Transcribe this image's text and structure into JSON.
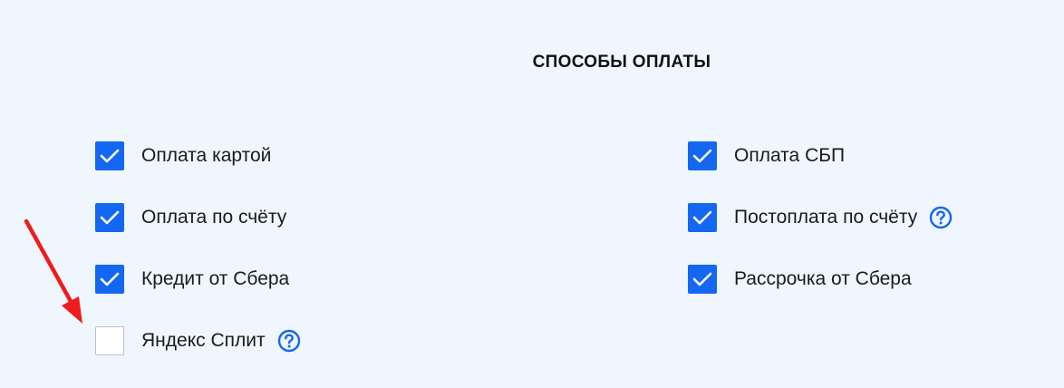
{
  "section": {
    "title": "СПОСОБЫ ОПЛАТЫ"
  },
  "colors": {
    "background": "#eff6fe",
    "accent": "#1467f0",
    "annotation_arrow": "#ee1c1c"
  },
  "payment_methods": [
    {
      "label": "Оплата картой",
      "checked": true,
      "help": false
    },
    {
      "label": "Оплата СБП",
      "checked": true,
      "help": false
    },
    {
      "label": "Оплата по счёту",
      "checked": true,
      "help": false
    },
    {
      "label": "Постоплата по счёту",
      "checked": true,
      "help": true
    },
    {
      "label": "Кредит от Сбера",
      "checked": true,
      "help": false
    },
    {
      "label": "Рассрочка от Сбера",
      "checked": true,
      "help": false
    },
    {
      "label": "Яндекс Сплит",
      "checked": false,
      "help": true
    }
  ],
  "icons": {
    "check": "check-icon",
    "help": "question-circle-icon",
    "annotation": "red-arrow-annotation"
  }
}
